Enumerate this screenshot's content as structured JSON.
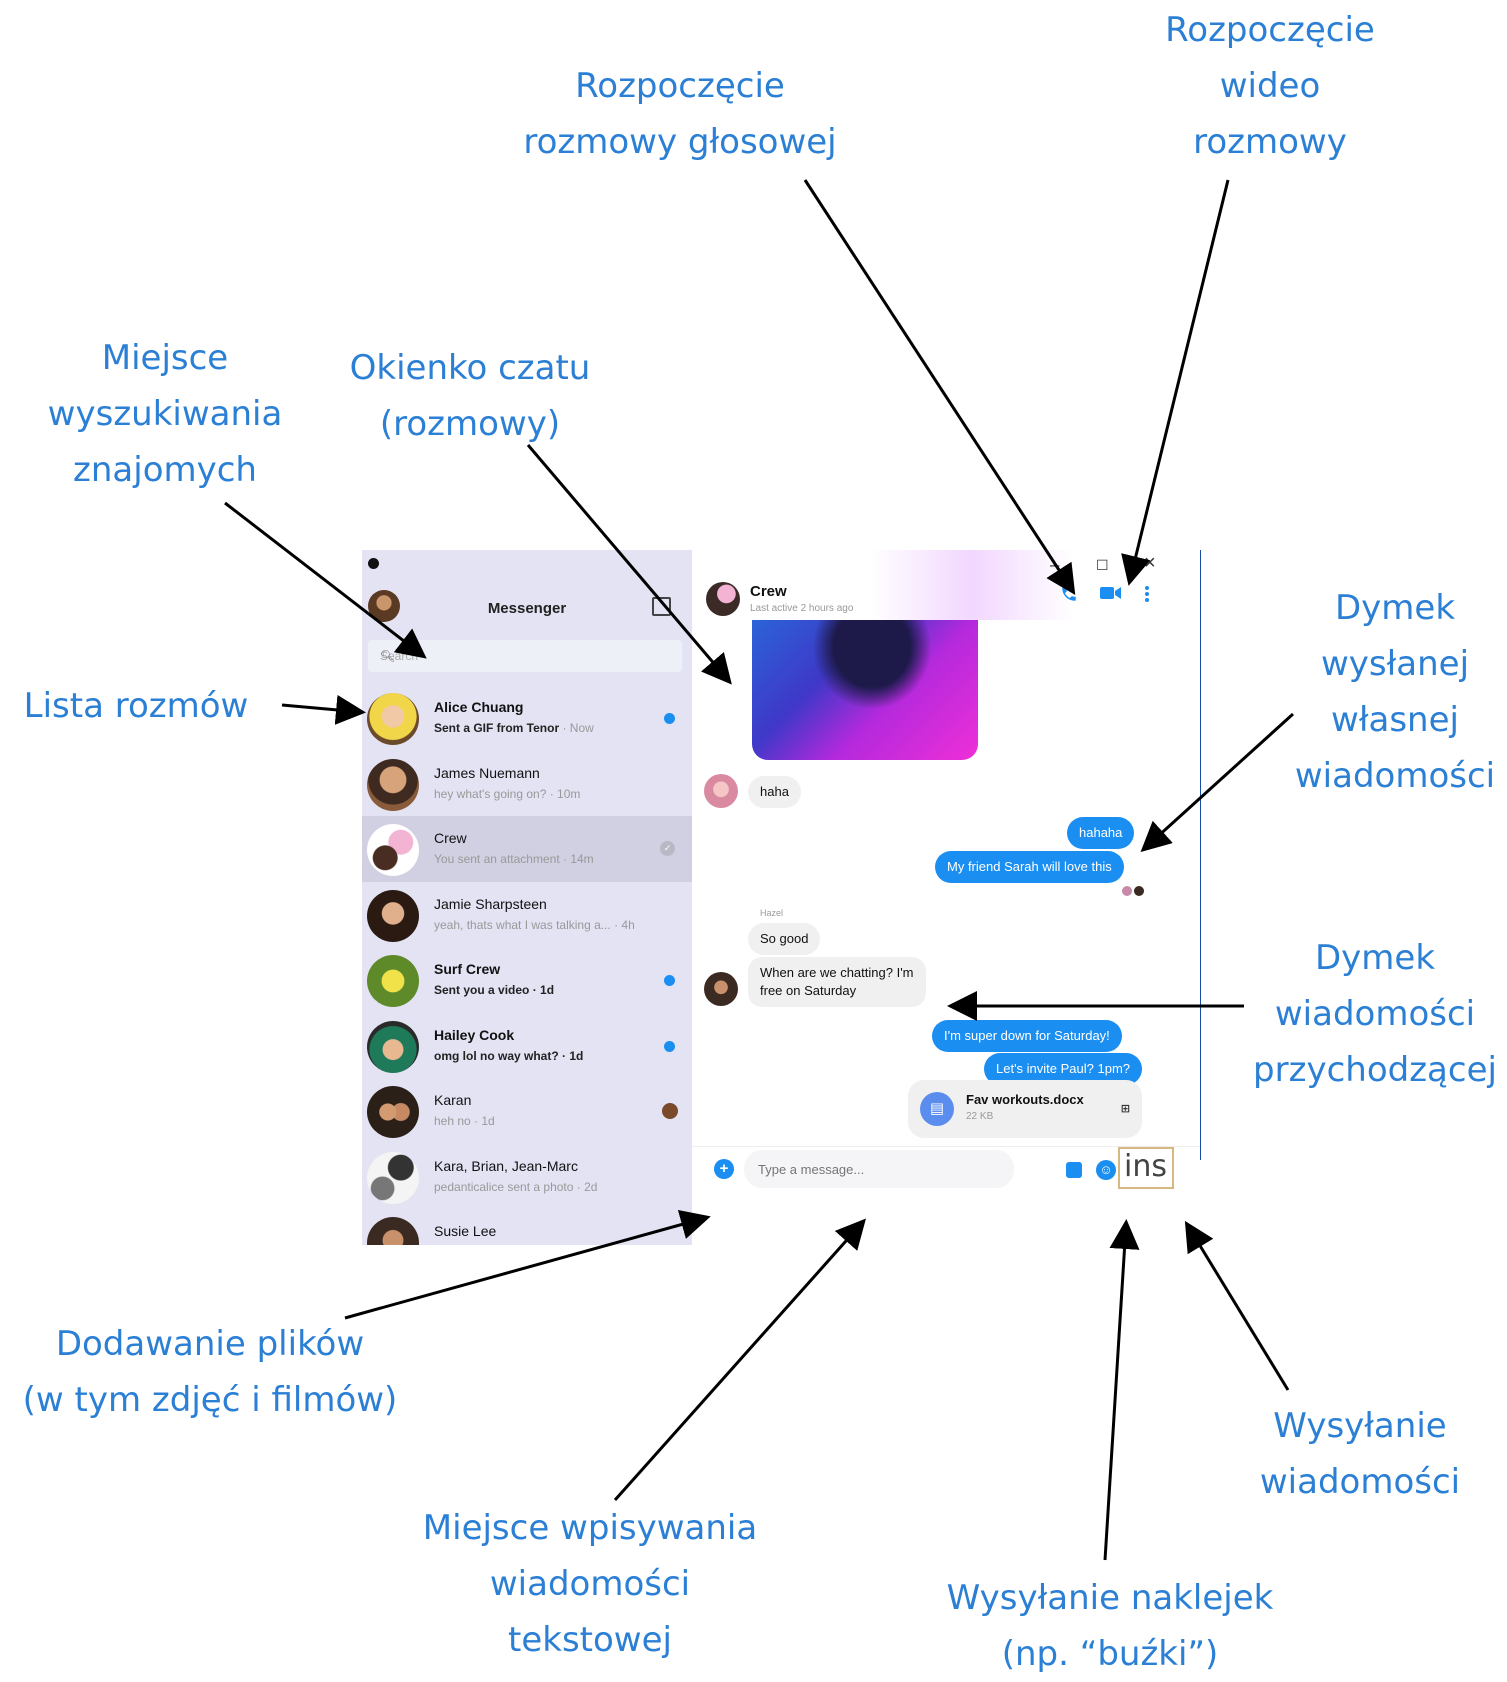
{
  "annotations": {
    "voice_call": [
      "Rozpoczęcie",
      "rozmowy głosowej"
    ],
    "video_call": [
      "Rozpoczęcie",
      "wideo",
      "rozmowy"
    ],
    "search": [
      "Miejsce",
      "wyszukiwania",
      "znajomych"
    ],
    "chat_window": [
      "Okienko czatu",
      "(rozmowy)"
    ],
    "conversation_list": [
      "Lista rozmów"
    ],
    "sent_bubble": [
      "Dymek",
      "wysłanej",
      "własnej",
      "wiadomości"
    ],
    "incoming_bubble": [
      "Dymek",
      "wiadomości",
      "przychodzącej"
    ],
    "attach": [
      "Dodawanie plików",
      "(w tym zdjęć i filmów)"
    ],
    "message_input": [
      "Miejsce wpisywania",
      "wiadomości",
      "tekstowej"
    ],
    "stickers": [
      "Wysyłanie naklejek",
      "(np. “buźki”)"
    ],
    "send": [
      "Wysyłanie",
      "wiadomości"
    ]
  },
  "app": {
    "title": "Messenger",
    "search_placeholder": "Search",
    "window_controls": {
      "minimize": "–",
      "maximize": "☐",
      "close": "×"
    }
  },
  "conversations": [
    {
      "name": "Alice Chuang",
      "preview": "Sent a GIF from Tenor",
      "time": " · Now",
      "unread": true
    },
    {
      "name": "James Nuemann",
      "preview": "hey what's going on? · 10m",
      "time": "",
      "unread": false
    },
    {
      "name": "Crew",
      "preview": "You sent an attachment · 14m",
      "time": "",
      "unread": false,
      "selected": true
    },
    {
      "name": "Jamie Sharpsteen",
      "preview": "yeah, thats what I was talking a... · 4h",
      "time": "",
      "unread": false
    },
    {
      "name": "Surf Crew",
      "preview": "Sent you a video · 1d",
      "time": "",
      "unread": true
    },
    {
      "name": "Hailey Cook",
      "preview": "omg lol no way what? · 1d",
      "time": "",
      "unread": true
    },
    {
      "name": "Karan",
      "preview": "heh no · 1d",
      "time": "",
      "unread": false
    },
    {
      "name": "Kara, Brian, Jean-Marc",
      "preview": "pedanticalice sent a photo · 2d",
      "time": "",
      "unread": false
    },
    {
      "name": "Susie Lee",
      "preview": "",
      "time": "",
      "unread": false
    }
  ],
  "chat": {
    "name": "Crew",
    "status": "Last active 2 hours ago",
    "messages": {
      "m1": "haha",
      "m2": "hahaha",
      "m3": "My friend Sarah will love this",
      "sender": "Hazel",
      "m4": "So good",
      "m5_line1": "When are we chatting? I'm",
      "m5_line2": "free on Saturday",
      "m6": "I'm super down for Saturday!",
      "m7": "Let's invite Paul? 1pm?"
    },
    "file": {
      "name": "Fav workouts.docx",
      "size": "22 KB"
    },
    "input_placeholder": "Type a message...",
    "send_label": "ins"
  },
  "colors": {
    "accent": "#1b8ef2",
    "annotation": "#2b7fd4",
    "sidebar": "#e3e3f4"
  }
}
